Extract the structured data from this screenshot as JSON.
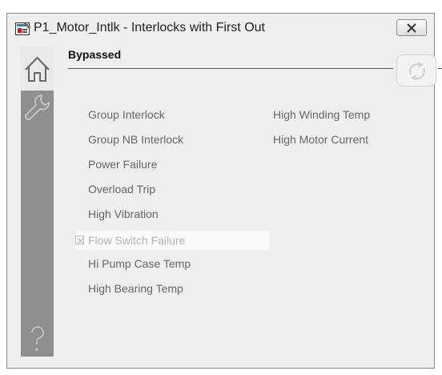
{
  "window": {
    "title": "P1_Motor_Intlk - Interlocks with First Out"
  },
  "section": {
    "title": "Bypassed"
  },
  "interlocks": {
    "column1": [
      {
        "label": "Group Interlock",
        "bypassed": false
      },
      {
        "label": "Group NB Interlock",
        "bypassed": false
      },
      {
        "label": "Power Failure",
        "bypassed": false
      },
      {
        "label": "Overload Trip",
        "bypassed": false
      },
      {
        "label": "High Vibration",
        "bypassed": false
      },
      {
        "label": "Flow Switch Failure",
        "bypassed": true
      },
      {
        "label": "Hi Pump Case Temp",
        "bypassed": false
      },
      {
        "label": "High Bearing Temp",
        "bypassed": false
      }
    ],
    "column2": [
      {
        "label": "High Winding Temp",
        "bypassed": false
      },
      {
        "label": "High Motor Current",
        "bypassed": false
      }
    ]
  },
  "icons": {
    "app": "faceplate-app-icon",
    "close": "close-icon",
    "home": "home-icon",
    "maintenance": "wrench-icon",
    "help": "question-mark-icon",
    "reset": "reset-arrows-icon"
  },
  "colors": {
    "sidebar": "#8f8f8f",
    "text": "#666666",
    "bypassed_text": "#b3b3b3"
  }
}
